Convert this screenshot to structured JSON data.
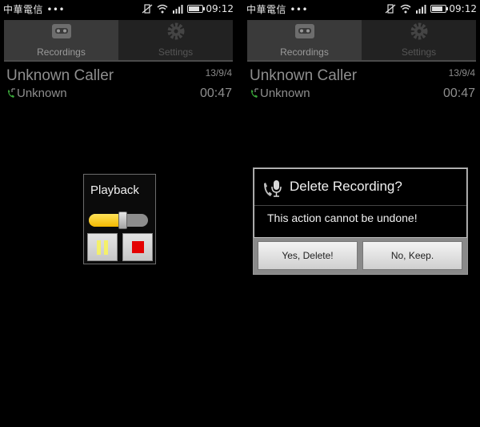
{
  "screens": [
    {
      "statusbar": {
        "carrier": "中華電信 •••",
        "time": "09:12"
      },
      "tabs": [
        {
          "label": "Recordings",
          "icon": "cassette-icon"
        },
        {
          "label": "Settings",
          "icon": "gear-icon"
        }
      ],
      "recording": {
        "title": "Unknown Caller",
        "date": "13/9/4",
        "number": "Unknown",
        "duration": "00:47"
      },
      "playback": {
        "title": "Playback",
        "progress_fraction": 0.57
      }
    },
    {
      "statusbar": {
        "carrier": "中華電信 •••",
        "time": "09:12"
      },
      "tabs": [
        {
          "label": "Recordings",
          "icon": "cassette-icon"
        },
        {
          "label": "Settings",
          "icon": "gear-icon"
        }
      ],
      "recording": {
        "title": "Unknown Caller",
        "date": "13/9/4",
        "number": "Unknown",
        "duration": "00:47"
      },
      "delete_dialog": {
        "title": "Delete Recording?",
        "message": "This action cannot be undone!",
        "confirm_label": "Yes, Delete!",
        "cancel_label": "No, Keep."
      }
    }
  ],
  "colors": {
    "background": "#000000",
    "seek_fill": "#f3b800",
    "stop": "#e40000"
  }
}
